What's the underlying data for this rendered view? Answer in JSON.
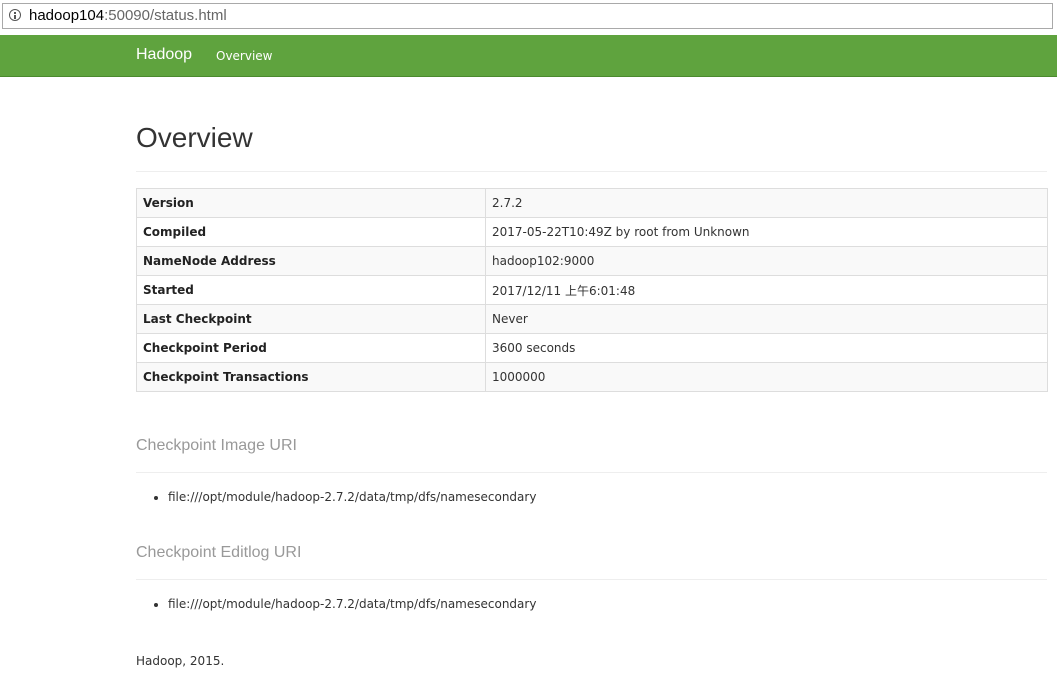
{
  "browser": {
    "url_host": "hadoop104",
    "url_rest": ":50090/status.html",
    "icon": "info-icon"
  },
  "navbar": {
    "brand": "Hadoop",
    "links": [
      {
        "label": "Overview"
      }
    ],
    "color": "#5fa33e"
  },
  "main": {
    "title": "Overview",
    "overview_table": [
      {
        "key": "Version",
        "value": "2.7.2"
      },
      {
        "key": "Compiled",
        "value": "2017-05-22T10:49Z by root from Unknown"
      },
      {
        "key": "NameNode Address",
        "value": "hadoop102:9000"
      },
      {
        "key": "Started",
        "value": "2017/12/11 上午6:01:48"
      },
      {
        "key": "Last Checkpoint",
        "value": "Never"
      },
      {
        "key": "Checkpoint Period",
        "value": "3600 seconds"
      },
      {
        "key": "Checkpoint Transactions",
        "value": "1000000"
      }
    ],
    "checkpoint_image": {
      "title": "Checkpoint Image URI",
      "items": [
        "file:///opt/module/hadoop-2.7.2/data/tmp/dfs/namesecondary"
      ]
    },
    "checkpoint_editlog": {
      "title": "Checkpoint Editlog URI",
      "items": [
        "file:///opt/module/hadoop-2.7.2/data/tmp/dfs/namesecondary"
      ]
    }
  },
  "footer": {
    "text": "Hadoop, 2015."
  }
}
